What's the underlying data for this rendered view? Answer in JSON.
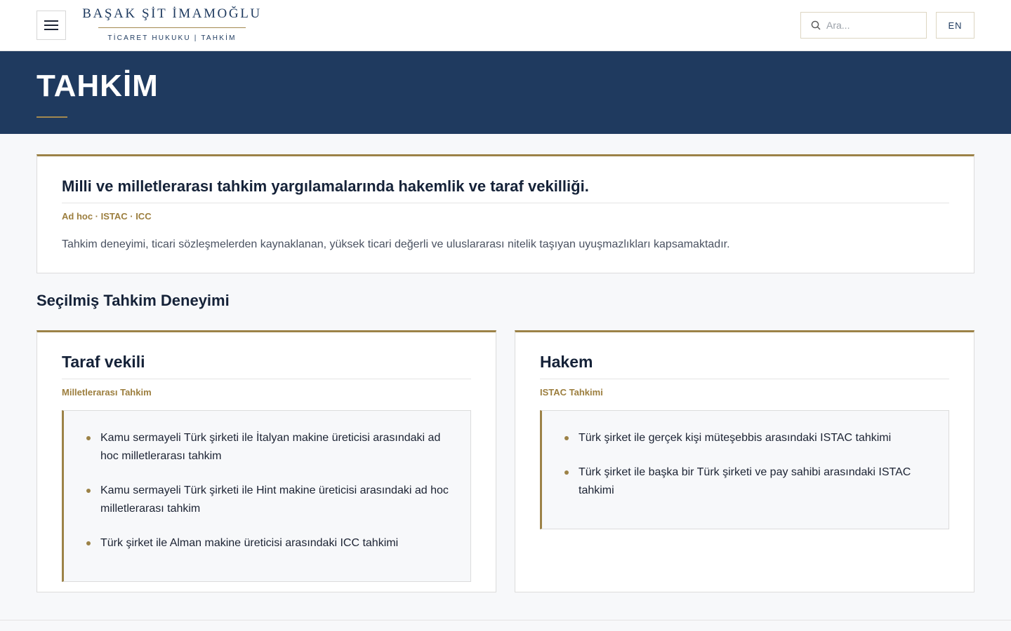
{
  "header": {
    "logo_name": "BAŞAK ŞİT İMAMOĞLU",
    "logo_tagline": "TİCARET HUKUKU | TAHKİM",
    "search_placeholder": "Ara...",
    "lang_label": "EN"
  },
  "hero": {
    "title": "TAHKİM"
  },
  "intro": {
    "title": "Milli ve milletlerarası tahkim yargılamalarında hakemlik ve taraf vekilliği.",
    "tags": "Ad hoc · ISTAC · ICC",
    "description": "Tahkim deneyimi, ticari sözleşmelerden kaynaklanan, yüksek ticari değerli ve uluslararası nitelik taşıyan uyuşmazlıkları kapsamaktadır."
  },
  "section": {
    "title": "Seçilmiş Tahkim Deneyimi"
  },
  "experience": [
    {
      "title": "Taraf vekili",
      "subtitle": "Milletlerarası Tahkim",
      "items": [
        "Kamu sermayeli Türk şirketi ile İtalyan makine üreticisi arasındaki ad hoc milletlerarası tahkim",
        "Kamu sermayeli Türk şirketi ile Hint makine üreticisi arasındaki ad hoc milletlerarası tahkim",
        "Türk şirket ile Alman makine üreticisi arasındaki ICC tahkimi"
      ]
    },
    {
      "title": "Hakem",
      "subtitle": "ISTAC Tahkimi",
      "items": [
        "Türk şirket ile gerçek kişi müteşebbis arasındaki ISTAC tahkimi",
        "Türk şirket ile başka bir Türk şirketi ve pay sahibi arasındaki ISTAC tahkimi"
      ]
    }
  ],
  "colors": {
    "navy": "#1f3a5f",
    "gold": "#9c8247",
    "background": "#f7f8fa"
  },
  "icons": {
    "menu": "hamburger-menu-icon",
    "search": "search-icon"
  }
}
